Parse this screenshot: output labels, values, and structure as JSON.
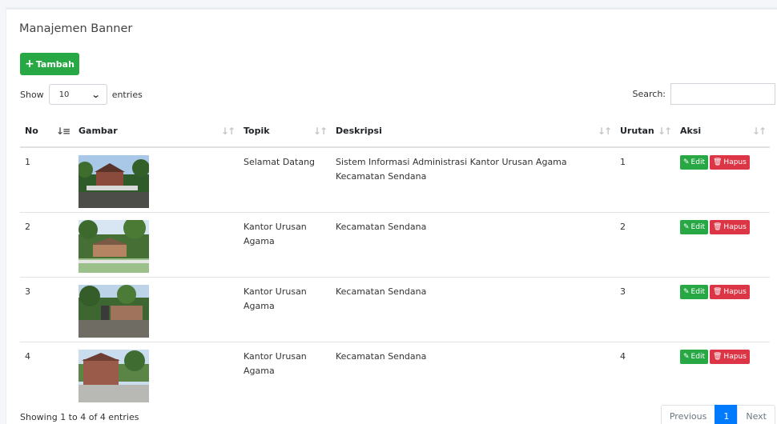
{
  "page": {
    "title": "Manajemen Banner"
  },
  "toolbar": {
    "add_label": "Tambah"
  },
  "length": {
    "show_label": "Show",
    "selected": "10",
    "entries_label": "entries"
  },
  "search": {
    "label": "Search:",
    "value": ""
  },
  "table": {
    "headers": [
      "No",
      "Gambar",
      "Topik",
      "Deskripsi",
      "Urutan",
      "Aksi"
    ],
    "rows": [
      {
        "no": "1",
        "topik": "Selamat Datang",
        "deskripsi": "Sistem Informasi Administrasi Kantor Urusan Agama Kecamatan Sendana",
        "urutan": "1"
      },
      {
        "no": "2",
        "topik": "Kantor Urusan Agama",
        "deskripsi": "Kecamatan Sendana",
        "urutan": "2"
      },
      {
        "no": "3",
        "topik": "Kantor Urusan Agama",
        "deskripsi": "Kecamatan Sendana",
        "urutan": "3"
      },
      {
        "no": "4",
        "topik": "Kantor Urusan Agama",
        "deskripsi": "Kecamatan Sendana",
        "urutan": "4"
      }
    ],
    "edit_label": "Edit",
    "delete_label": "Hapus"
  },
  "footer": {
    "info": "Showing 1 to 4 of 4 entries"
  },
  "pagination": {
    "previous": "Previous",
    "current": "1",
    "next": "Next"
  },
  "colors": {
    "success": "#28a745",
    "danger": "#dc3545",
    "primary": "#007bff"
  },
  "icons": {
    "add": "plus-icon",
    "edit": "edit-icon",
    "delete": "trash-icon",
    "sort": "sort-icon",
    "dropdown": "chevron-down-icon"
  }
}
